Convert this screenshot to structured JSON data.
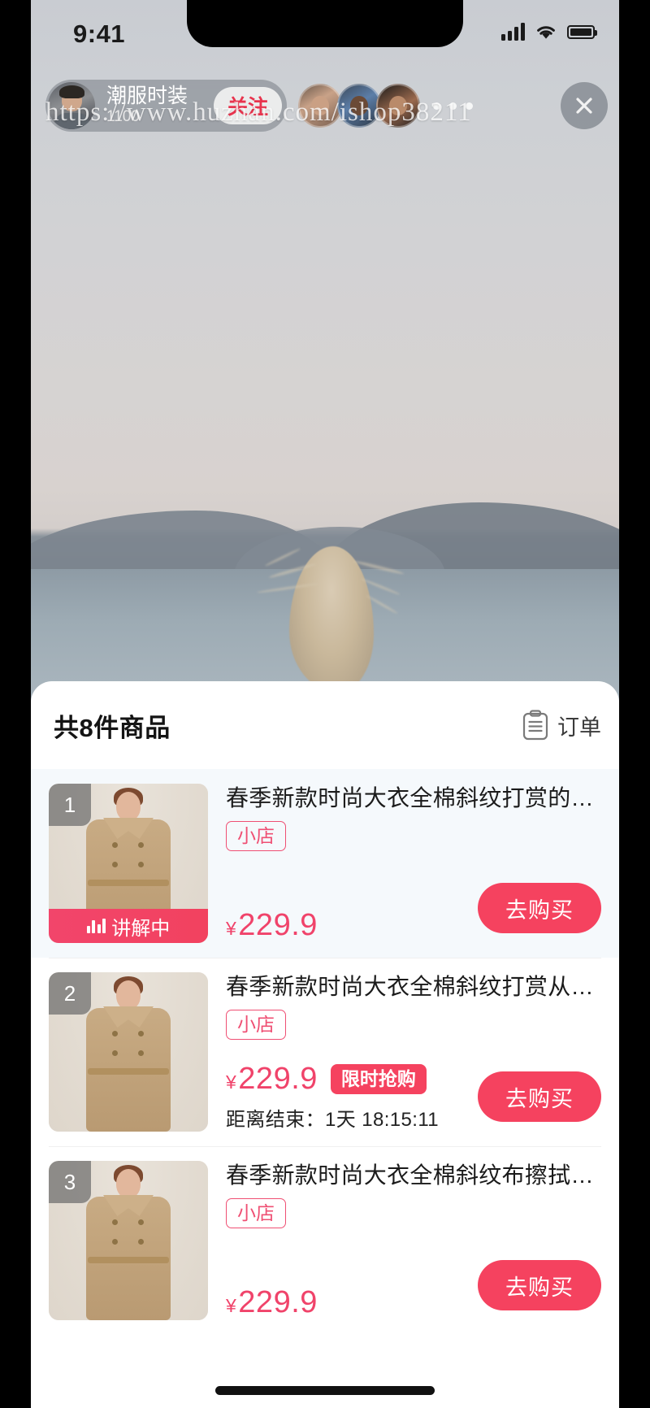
{
  "status_bar": {
    "time": "9:41",
    "signal_icon": "cellular-signal-icon",
    "wifi_icon": "wifi-icon",
    "battery_icon": "battery-icon"
  },
  "live_header": {
    "anchor_name": "潮服时装",
    "anchor_count": "1100",
    "follow_label": "关注",
    "viewer_count_more": "···",
    "close_label": "×"
  },
  "watermark": "https://www.huzhan.com/ishop38211",
  "sheet": {
    "title": "共8件商品",
    "order_label": "订单",
    "order_icon": "clipboard-icon"
  },
  "products": [
    {
      "index": "1",
      "title": "春季新款时尚大衣全棉斜纹打赏的…",
      "shop_tag": "小店",
      "currency": "¥",
      "price": "229.9",
      "buy_label": "去购买",
      "live_banner": "讲解中",
      "flash_badge": "",
      "countdown": "",
      "highlight": true
    },
    {
      "index": "2",
      "title": "春季新款时尚大衣全棉斜纹打赏从…",
      "shop_tag": "小店",
      "currency": "¥",
      "price": "229.9",
      "buy_label": "去购买",
      "live_banner": "",
      "flash_badge": "限时抢购",
      "countdown": "距离结束：1天 18:15:11",
      "highlight": false
    },
    {
      "index": "3",
      "title": "春季新款时尚大衣全棉斜纹布擦拭…",
      "shop_tag": "小店",
      "currency": "¥",
      "price": "229.9",
      "buy_label": "去购买",
      "live_banner": "",
      "flash_badge": "",
      "countdown": "",
      "highlight": false
    }
  ],
  "colors": {
    "accent_red": "#f5425f",
    "price_red": "#f0436a",
    "tag_pink": "#ef4f73",
    "highlight_bg": "#f5f9fc"
  }
}
